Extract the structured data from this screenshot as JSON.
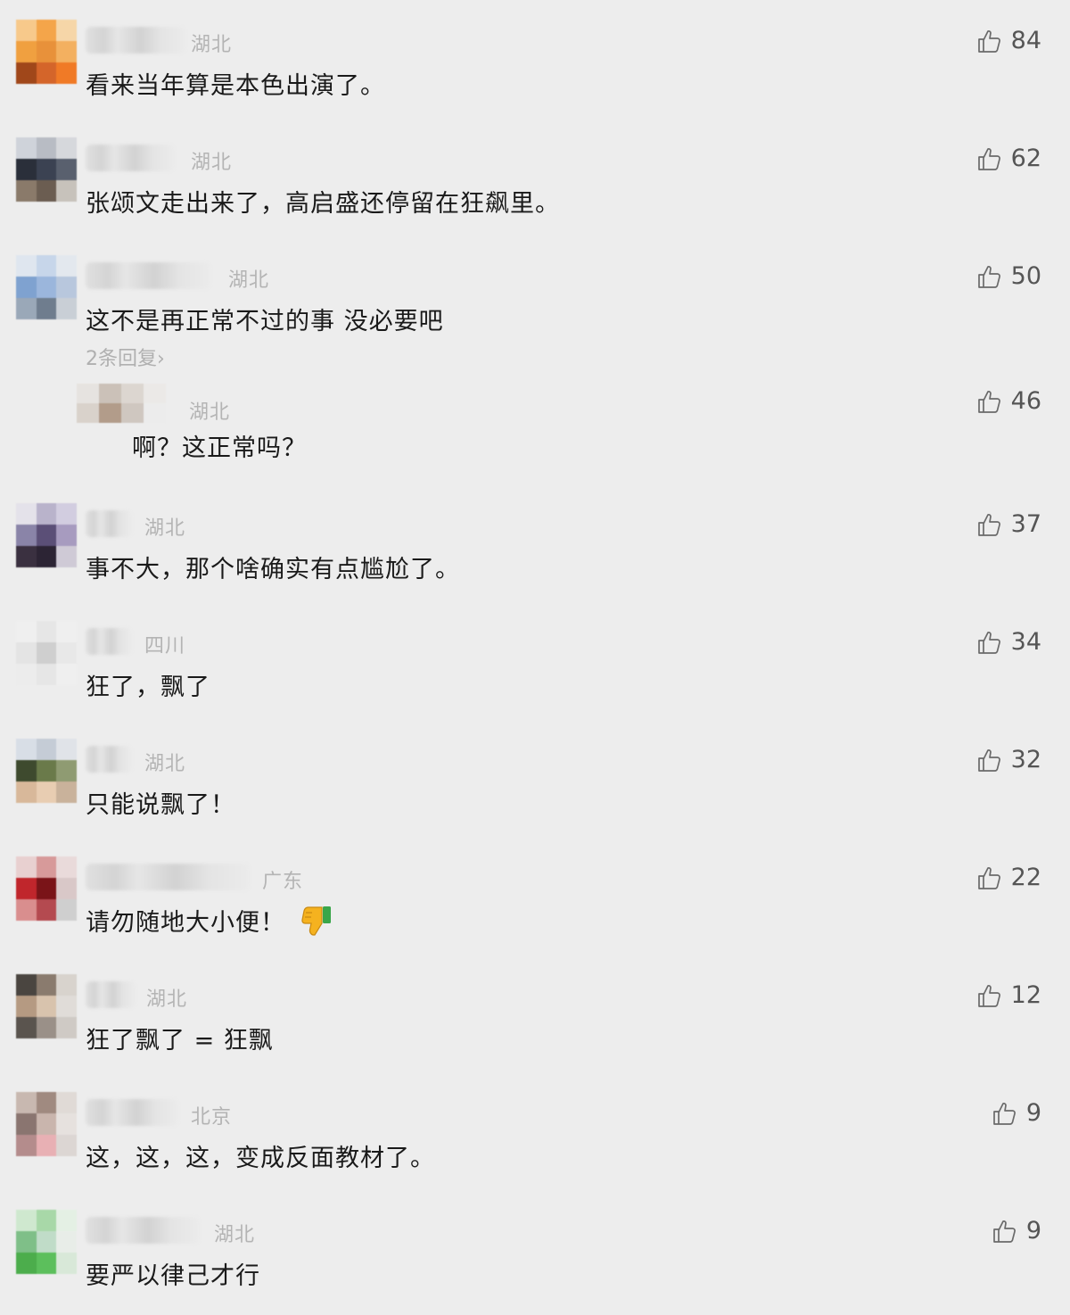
{
  "comments": [
    {
      "location": "湖北",
      "text": "看来当年算是本色出演了。",
      "likes": "84"
    },
    {
      "location": "湖北",
      "text": "张颂文走出来了，高启盛还停留在狂飙里。",
      "likes": "62"
    },
    {
      "location": "湖北",
      "text": "这不是再正常不过的事  没必要吧",
      "likes": "50",
      "replies_link": "2条回复›"
    },
    {
      "location": "湖北",
      "text": "啊？这正常吗？",
      "likes": "46"
    },
    {
      "location": "湖北",
      "text": "事不大，那个啥确实有点尴尬了。",
      "likes": "37"
    },
    {
      "location": "四川",
      "text": "狂了，飘了",
      "likes": "34"
    },
    {
      "location": "湖北",
      "text": "只能说飘了！",
      "likes": "32"
    },
    {
      "location": "广东",
      "text": "请勿随地大小便！",
      "likes": "22",
      "emoji": "thumbs-down-emoji"
    },
    {
      "location": "湖北",
      "text": "狂了飘了 = 狂飘",
      "likes": "12"
    },
    {
      "location": "北京",
      "text": "这，这，这，变成反面教材了。",
      "likes": "9"
    },
    {
      "location": "湖北",
      "text": "要严以律己才行",
      "likes": "9"
    }
  ],
  "icons": {
    "like": "thumbs-up-icon"
  },
  "colors": {
    "background": "#ededed",
    "text": "#1a1a1a",
    "meta": "#b4b4b4",
    "count": "#555555"
  }
}
